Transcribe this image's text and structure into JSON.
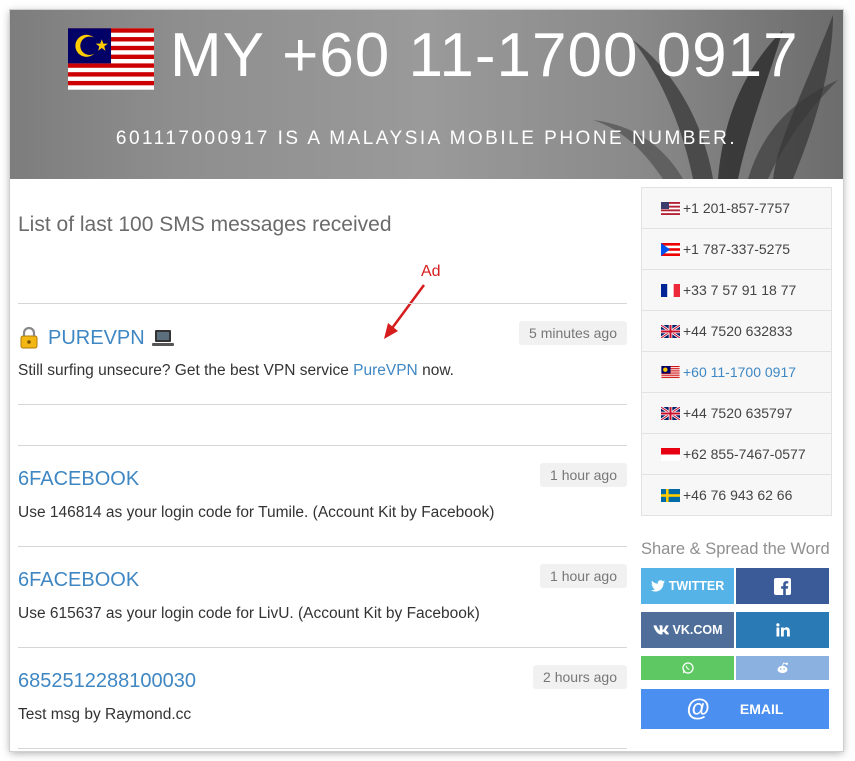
{
  "header": {
    "title": "MY +60 11-1700 0917",
    "subtitle": "601117000917 IS A MALAYSIA MOBILE PHONE NUMBER."
  },
  "main": {
    "list_title": "List of last 100 SMS messages received",
    "ad_label": "Ad",
    "ad": {
      "sender": "PUREVPN",
      "time": "5 minutes ago",
      "body_prefix": "Still surfing unsecure? Get the best VPN service ",
      "body_link": "PureVPN",
      "body_suffix": " now."
    },
    "messages": [
      {
        "sender": "6FACEBOOK",
        "time": "1 hour ago",
        "body": "Use 146814 as your login code for Tumile. (Account Kit by Facebook)"
      },
      {
        "sender": "6FACEBOOK",
        "time": "1 hour ago",
        "body": "Use 615637 as your login code for LivU. (Account Kit by Facebook)"
      },
      {
        "sender": "6852512288100030",
        "time": "2 hours ago",
        "body": "Test msg by Raymond.cc"
      }
    ]
  },
  "sidebar": {
    "numbers": [
      {
        "flag": "us",
        "number": "+1 201-857-7757"
      },
      {
        "flag": "pr",
        "number": "+1 787-337-5275"
      },
      {
        "flag": "fr",
        "number": "+33 7 57 91 18 77"
      },
      {
        "flag": "gb",
        "number": "+44 7520 632833"
      },
      {
        "flag": "my",
        "number": "+60 11-1700 0917"
      },
      {
        "flag": "gb",
        "number": "+44 7520 635797"
      },
      {
        "flag": "id",
        "number": "+62 855-7467-0577"
      },
      {
        "flag": "se",
        "number": "+46 76 943 62 66"
      }
    ],
    "share_title": "Share & Spread the Word",
    "share": {
      "twitter": "TWITTER",
      "vk": "VK.COM",
      "email": "EMAIL"
    }
  },
  "colors": {
    "link": "#3f87c3",
    "ad_red": "#d61c1c",
    "twitter": "#55b3e8",
    "facebook": "#3a5a98",
    "vk": "#4f6f9a",
    "linkedin": "#2a7ab5",
    "whatsapp": "#5ec962",
    "reddit": "#8ab1df",
    "email": "#4b8ff0"
  }
}
